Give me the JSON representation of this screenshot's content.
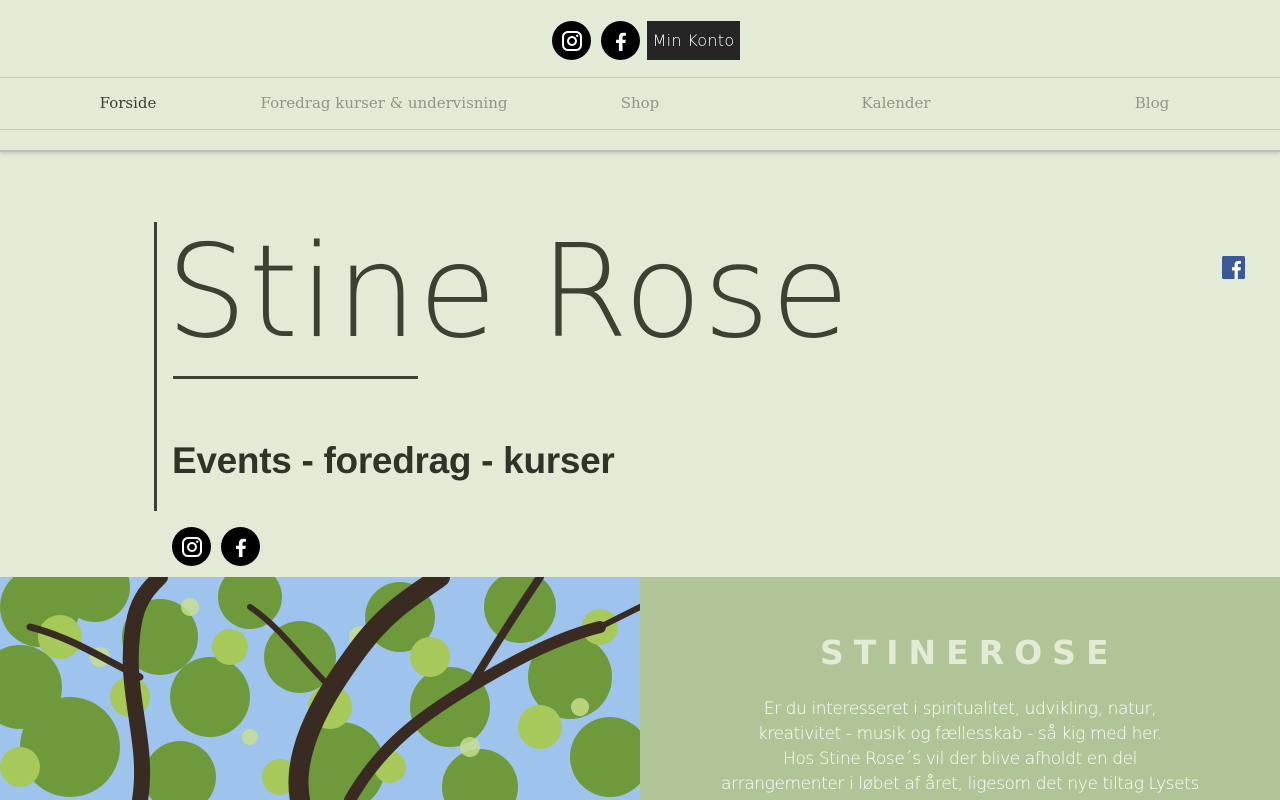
{
  "header": {
    "account_button": "Min Konto",
    "social_icons": [
      "instagram-icon",
      "facebook-icon"
    ]
  },
  "nav": {
    "items": [
      {
        "label": "Forside",
        "active": true
      },
      {
        "label": "Foredrag kurser & undervisning",
        "active": false
      },
      {
        "label": "Shop",
        "active": false
      },
      {
        "label": "Kalender",
        "active": false
      },
      {
        "label": "Blog",
        "active": false
      }
    ]
  },
  "hero": {
    "title": "Stine Rose",
    "subtitle": "Events -  foredrag - kurser",
    "social_icons": [
      "instagram-icon",
      "facebook-icon"
    ]
  },
  "sidebar": {
    "share_icon": "facebook-icon"
  },
  "photo": {
    "icon": "tree-canopy-photo"
  },
  "intro": {
    "heading": "STINEROSE",
    "paragraph_1": "Er du interesseret i spiritualitet, udvikling, natur, kreativitet - musik og fællesskab - så kig med her.",
    "paragraph_2": "Hos Stine Rose´s vil der blive afholdt en del arrangementer i løbet af året, ligesom det nye tiltag Lysets Cafe - en spirit"
  },
  "colors": {
    "page_background": "#e3ebd7",
    "text_dark": "#3c4233",
    "nav_inactive": "#8f9689",
    "button_background": "#252525",
    "panel_background": "#b1c497",
    "facebook_blue": "#3b5998"
  }
}
